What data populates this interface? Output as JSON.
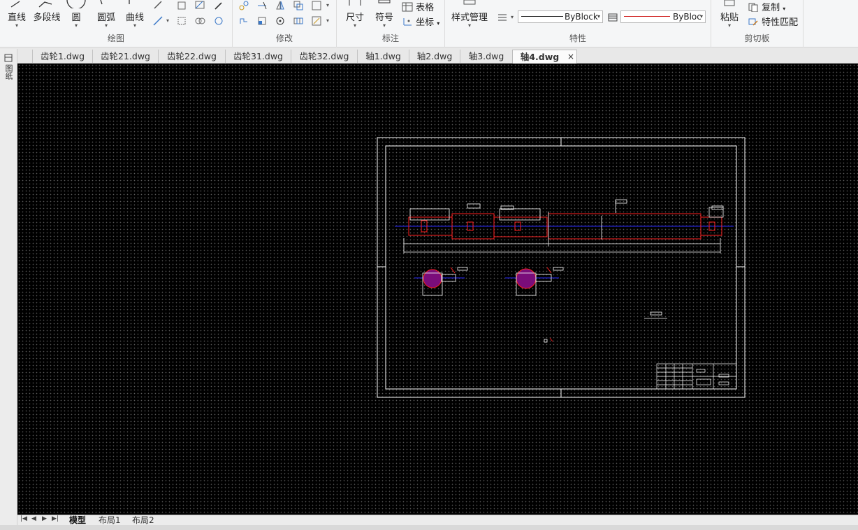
{
  "ribbon": {
    "draw_group": {
      "title": "绘图",
      "line": "直线",
      "polyline": "多段线",
      "circle": "圆",
      "arc": "圆弧",
      "curve": "曲线"
    },
    "modify_group": {
      "title": "修改"
    },
    "annotate_group": {
      "title": "标注",
      "dimension": "尺寸",
      "symbol": "符号",
      "table": "表格",
      "coordinate": "坐标"
    },
    "properties_group": {
      "title": "特性",
      "style_manager": "样式管理",
      "linetype_value": "ByBlock",
      "color_value": "ByBloc"
    },
    "clipboard_group": {
      "title": "剪切板",
      "paste": "粘贴",
      "copy": "复制",
      "match_properties": "特性匹配"
    }
  },
  "tabs": [
    {
      "label": "齿轮1.dwg"
    },
    {
      "label": "齿轮21.dwg"
    },
    {
      "label": "齿轮22.dwg"
    },
    {
      "label": "齿轮31.dwg"
    },
    {
      "label": "齿轮32.dwg"
    },
    {
      "label": "轴1.dwg"
    },
    {
      "label": "轴2.dwg"
    },
    {
      "label": "轴3.dwg"
    },
    {
      "label": "轴4.dwg",
      "active": true,
      "close": "×"
    }
  ],
  "left_strip_label": "图纸",
  "layout_tabs": [
    {
      "label": "模型",
      "active": true
    },
    {
      "label": "布局1"
    },
    {
      "label": "布局2"
    }
  ],
  "colors": {
    "canvas": "#000000",
    "frame": "#ffffff",
    "shaft": "#ff2020",
    "centerline": "#2a2aff",
    "hatch": "#c000c0"
  }
}
